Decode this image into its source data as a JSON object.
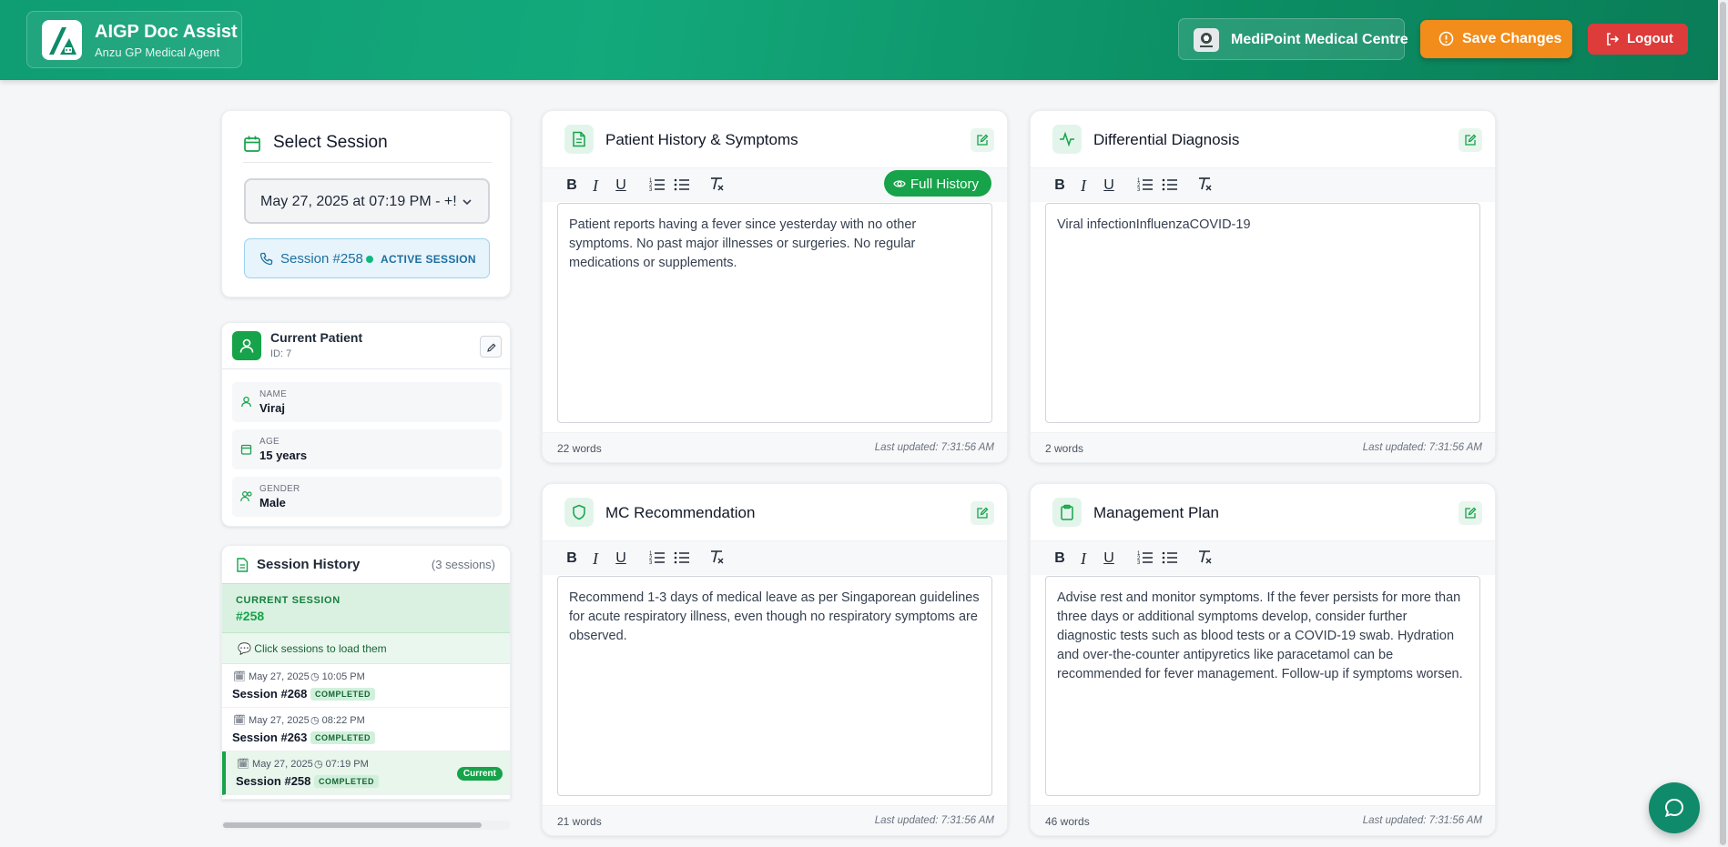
{
  "header": {
    "app_title": "AIGP Doc Assist",
    "app_subtitle": "Anzu GP Medical Agent",
    "clinic_name": "MediPoint Medical Centre",
    "save_label": "Save Changes",
    "logout_label": "Logout",
    "colors": {
      "brand_green": "#0f9d73",
      "save_orange": "#f28c1a",
      "logout_red": "#de3b3b"
    }
  },
  "session": {
    "title": "Select Session",
    "selected_value": "May 27, 2025 at 07:19 PM - +!",
    "active_session_id": "Session #258",
    "active_label": "ACTIVE SESSION"
  },
  "patient": {
    "heading": "Current Patient",
    "id": "ID: 7",
    "fields": [
      {
        "label": "NAME",
        "value": "Viraj",
        "icon": "user-icon"
      },
      {
        "label": "AGE",
        "value": "15 years",
        "icon": "calendar-icon"
      },
      {
        "label": "GENDER",
        "value": "Male",
        "icon": "users-icon"
      }
    ]
  },
  "history": {
    "title": "Session History",
    "count": "(3 sessions)",
    "current_label": "CURRENT SESSION",
    "current_id": "#258",
    "hint": "💬 Click sessions to load them",
    "items": [
      {
        "date": "May 27, 2025",
        "time": "10:05 PM",
        "name": "Session #268",
        "status": "COMPLETED"
      },
      {
        "date": "May 27, 2025",
        "time": "08:22 PM",
        "name": "Session #263",
        "status": "COMPLETED"
      },
      {
        "date": "May 27, 2025",
        "time": "07:19 PM",
        "name": "Session #258",
        "status": "COMPLETED",
        "badge": "Current"
      }
    ]
  },
  "cards": {
    "history_symptoms": {
      "title": "Patient History & Symptoms",
      "full_history_label": "Full History",
      "content": "Patient reports having a fever since yesterday with no other symptoms. No past major illnesses or surgeries. No regular medications or supplements.",
      "word_count": "22 words",
      "updated": "Last updated: 7:31:56 AM"
    },
    "differential": {
      "title": "Differential Diagnosis",
      "content": "Viral infectionInfluenzaCOVID-19",
      "word_count": "2 words",
      "updated": "Last updated: 7:31:56 AM"
    },
    "mc": {
      "title": "MC Recommendation",
      "content": "Recommend 1-3 days of medical leave as per Singaporean guidelines for acute respiratory illness, even though no respiratory symptoms are observed.",
      "word_count": "21 words",
      "updated": "Last updated: 7:31:56 AM"
    },
    "plan": {
      "title": "Management Plan",
      "content": "Advise rest and monitor symptoms. If the fever persists for more than three days or additional symptoms develop, consider further diagnostic tests such as blood tests or a COVID-19 swab. Hydration and over-the-counter antipyretics like paracetamol can be recommended for fever management. Follow-up if symptoms worsen.",
      "word_count": "46 words",
      "updated": "Last updated: 7:31:56 AM"
    }
  },
  "toolbar": {
    "bold": "B",
    "italic": "I",
    "underline": "U"
  }
}
